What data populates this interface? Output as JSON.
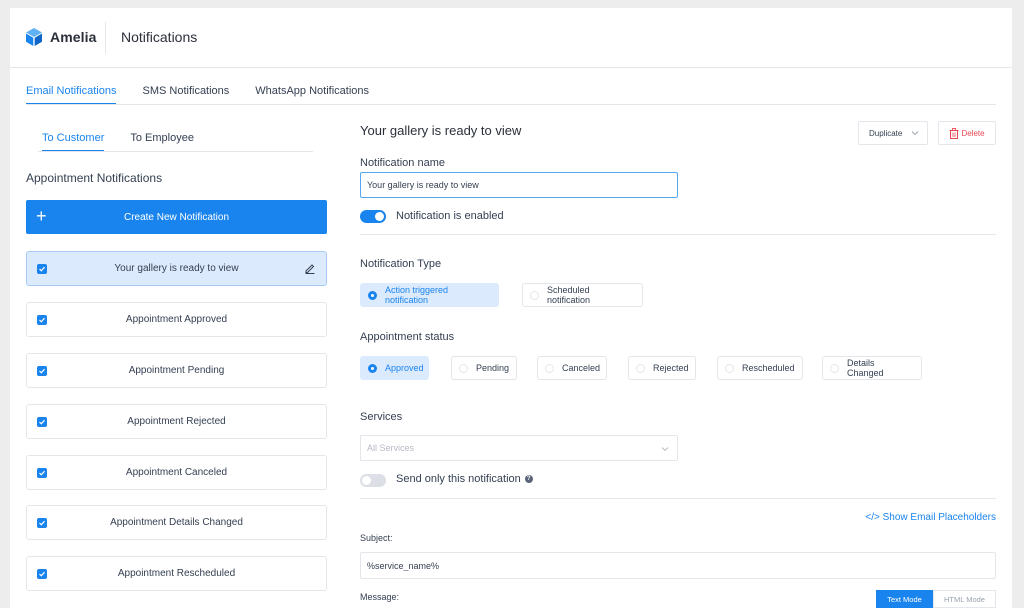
{
  "app": {
    "name": "Amelia",
    "page_title": "Notifications"
  },
  "tabs": [
    "Email Notifications",
    "SMS Notifications",
    "WhatsApp Notifications"
  ],
  "active_tab": "Email Notifications",
  "left": {
    "subtabs": [
      "To Customer",
      "To Employee"
    ],
    "section_title": "Appointment Notifications",
    "create_label": "Create New Notification",
    "items": [
      {
        "label": "Your gallery is ready to view",
        "selected": true
      },
      {
        "label": "Appointment Approved"
      },
      {
        "label": "Appointment Pending"
      },
      {
        "label": "Appointment Rejected"
      },
      {
        "label": "Appointment Canceled"
      },
      {
        "label": "Appointment Details Changed"
      },
      {
        "label": "Appointment Rescheduled"
      }
    ]
  },
  "detail": {
    "title": "Your gallery is ready to view",
    "duplicate_label": "Duplicate",
    "delete_label": "Delete",
    "name_label": "Notification name",
    "name_value": "Your gallery is ready to view",
    "enabled_label": "Notification is enabled",
    "enabled": true,
    "type_label": "Notification Type",
    "type_options": [
      "Action triggered notification",
      "Scheduled notification"
    ],
    "type_selected": "Action triggered notification",
    "status_label": "Appointment status",
    "status_options": [
      "Approved",
      "Pending",
      "Canceled",
      "Rejected",
      "Rescheduled",
      "Details Changed"
    ],
    "status_selected": "Approved",
    "services_label": "Services",
    "services_placeholder": "All Services",
    "send_only_label": "Send only this notification",
    "send_only": false,
    "placeholders_link": "</> Show Email Placeholders",
    "subject_label": "Subject:",
    "subject_value": "%service_name%",
    "message_label": "Message:",
    "text_mode_label": "Text Mode",
    "html_mode_label": "HTML Mode",
    "colors": {
      "accent": "#1a84ee",
      "danger": "#e94852"
    }
  }
}
